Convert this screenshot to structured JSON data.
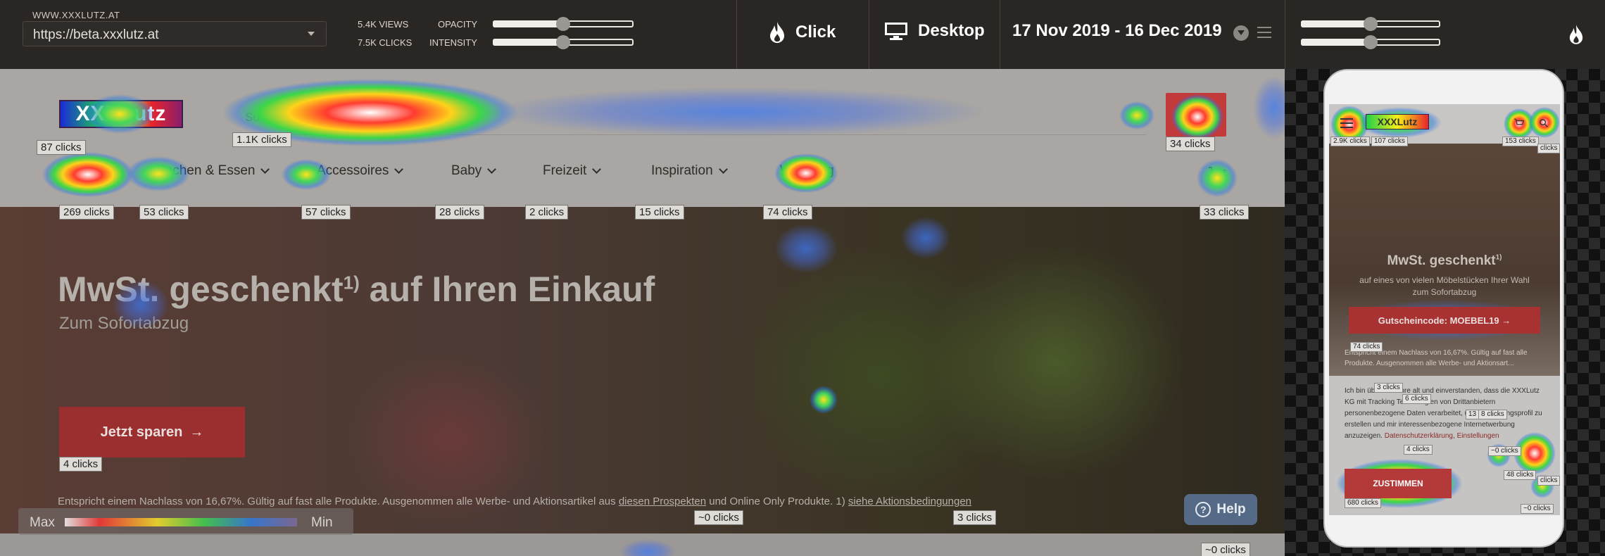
{
  "toolbar": {
    "site_label": "WWW.XXXLUTZ.AT",
    "site_url": "https://beta.xxxlutz.at",
    "views": "5.4K VIEWS",
    "clicks": "7.5K CLICKS",
    "opacity_label": "OPACITY",
    "intensity_label": "INTENSITY",
    "opacity_level": 0.5,
    "intensity_level": 0.5,
    "mode_label": "Click",
    "device_label": "Desktop",
    "date_range": "17 Nov 2019 - 16 Dec 2019",
    "mobile_opacity_level": 0.5,
    "mobile_intensity_level": 0.5
  },
  "site": {
    "search_placeholder": "Suchbegriff eingeben",
    "nav": [
      {
        "label": "Möbel"
      },
      {
        "label": "Kochen & Essen"
      },
      {
        "label": "Accessoires"
      },
      {
        "label": "Baby"
      },
      {
        "label": "Freizeit"
      },
      {
        "label": "Inspiration"
      },
      {
        "label": "Werbung"
      }
    ],
    "hero_title": "MwSt. geschenkt",
    "hero_title_sup": "1)",
    "hero_title_rest": " auf Ihren Einkauf",
    "hero_sub": "Zum Sofortabzug",
    "hero_cta": "Jetzt sparen",
    "hero_foot_text": "Entspricht einem Nachlass von 16,67%. Gültig auf fast alle Produkte. Ausgenommen alle Werbe- und Aktionsartikel aus ",
    "hero_foot_link1": "diesen Prospekten",
    "hero_foot_mid": " und Online Only Produkte. 1) ",
    "hero_foot_link2": "siehe Aktionsbedingungen"
  },
  "help_label": "Help",
  "scale": {
    "max": "Max",
    "min": "Min"
  },
  "clicks": {
    "logo": "87 clicks",
    "search": "1.1K clicks",
    "search_btn": "34 clicks",
    "nav_moebel": "269 clicks",
    "nav_kochen": "53 clicks",
    "nav_accessoires": "57 clicks",
    "nav_baby": "28 clicks",
    "nav_freizeit": "2 clicks",
    "nav_inspiration": "15 clicks",
    "nav_werbung": "74 clicks",
    "cart": "33 clicks",
    "cta": "4 clicks",
    "foot_link1": "~0 clicks",
    "foot_link2": "3 clicks",
    "bottom": "~0 clicks"
  },
  "mobile": {
    "logo": "XXXLutz",
    "title": "MwSt. geschenkt",
    "title_sup": "1)",
    "sub": "auf eines von vielen Möbelstücken Ihrer Wahl zum Sofortabzug",
    "code": "Gutscheincode: MOEBEL19",
    "fine": "Entspricht einem Nachlass von 16,67%. Gültig auf fast alle Produkte. Ausgenommen alle Werbe- und Aktionsart...",
    "cookie_text": "Ich bin über 16 Jahre alt und einverstanden, dass die XXXLutz KG mit Tracking Technologien von Drittanbietern personenbezogene Daten verarbeitet, um ein Nutzungsprofil zu erstellen und mir interessenbezogene Internetwerbung anzuzeigen.",
    "cookie_link1": "Datenschutzerklärung",
    "cookie_link2": "Einstellungen",
    "accept": "ZUSTIMMEN",
    "badges": {
      "menu": "2.9K clicks",
      "logo": "107 clicks",
      "cart": "153 clicks",
      "search": "clicks",
      "code": "74 clicks",
      "b1": "3 clicks",
      "b2": "6 clicks",
      "b3": "13",
      "b4": "8 clicks",
      "b5": "4 clicks",
      "b6": "~0 clicks",
      "b7": "48 clicks",
      "b8": "clicks",
      "accept": "680 clicks",
      "b9": "~0 clicks"
    }
  }
}
